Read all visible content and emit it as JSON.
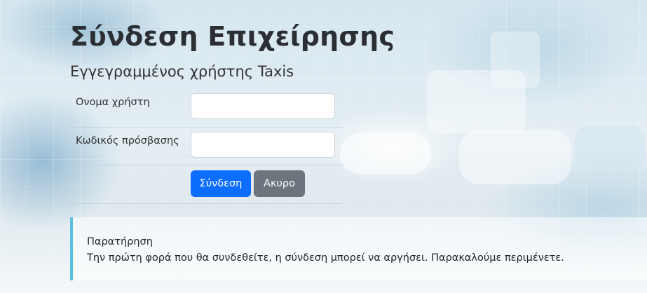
{
  "page": {
    "title": "Σύνδεση Επιχείρησης",
    "subtitle": "Εγγεγραμμένος χρήστης Taxis"
  },
  "form": {
    "username": {
      "label": "Ονομα χρήστη",
      "value": "",
      "placeholder": ""
    },
    "password": {
      "label": "Κωδικός πρόσβασης",
      "value": "",
      "placeholder": ""
    },
    "login_label": "Σύνδεση",
    "cancel_label": "Ακυρο"
  },
  "notice": {
    "title": "Παρατήρηση",
    "text": "Την πρώτη φορά που θα συνδεθείτε, η σύνδεση μπορεί να αργήσει. Παρακαλούμε περιμένετε."
  },
  "colors": {
    "primary": "#0d6efd",
    "secondary": "#6c757d",
    "notice_accent": "#5bc0de"
  }
}
